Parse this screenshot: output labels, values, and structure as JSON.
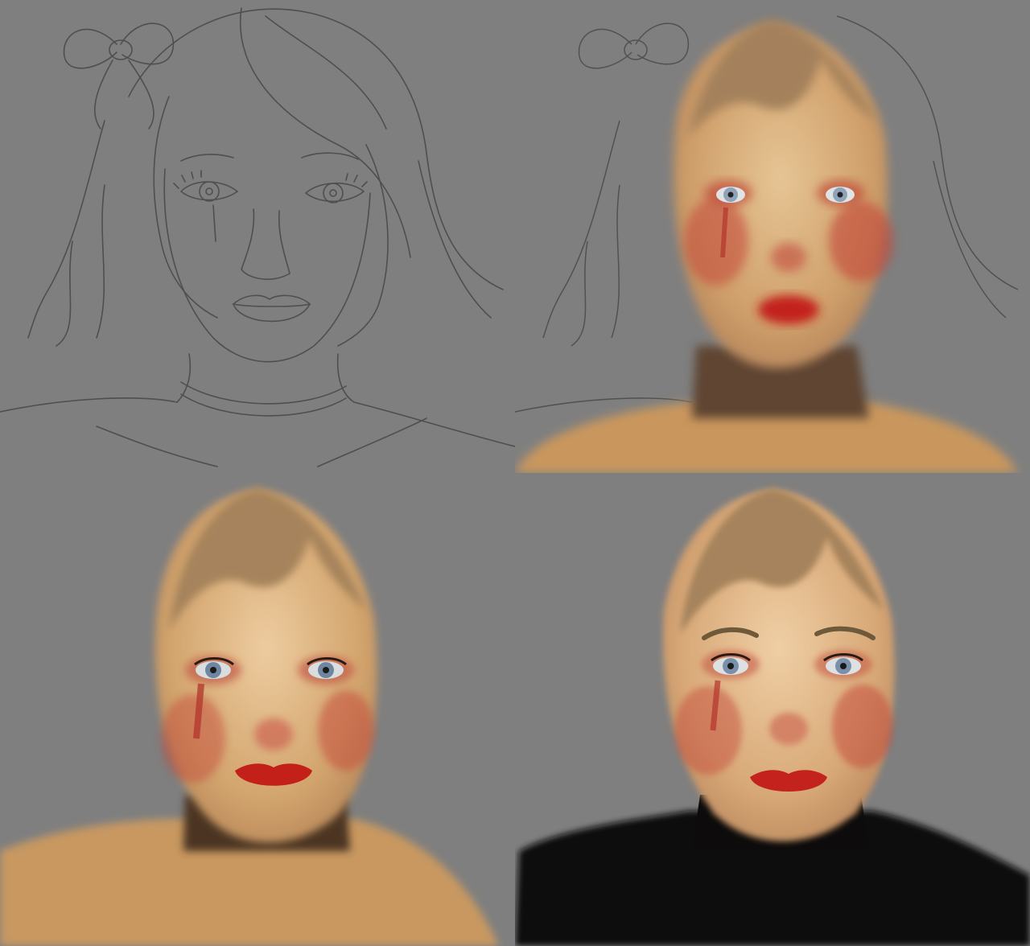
{
  "image": {
    "description_type": "digital painting progress grid",
    "background_color": "#7f7f7f",
    "sketch_stroke_color": "#4d4d4d",
    "skin_light": "#e8c79a",
    "skin_mid": "#d3a56e",
    "skin_shadow": "#9d6f47",
    "hair_color": "#a6835c",
    "blush_color": "#c9433a",
    "lip_color": "#c3231c",
    "eye_color": "#8ea3b8",
    "top_color": "#0d0b0b",
    "panels": [
      {
        "name": "sketch"
      },
      {
        "name": "blockin"
      },
      {
        "name": "rendering"
      },
      {
        "name": "final"
      }
    ]
  }
}
